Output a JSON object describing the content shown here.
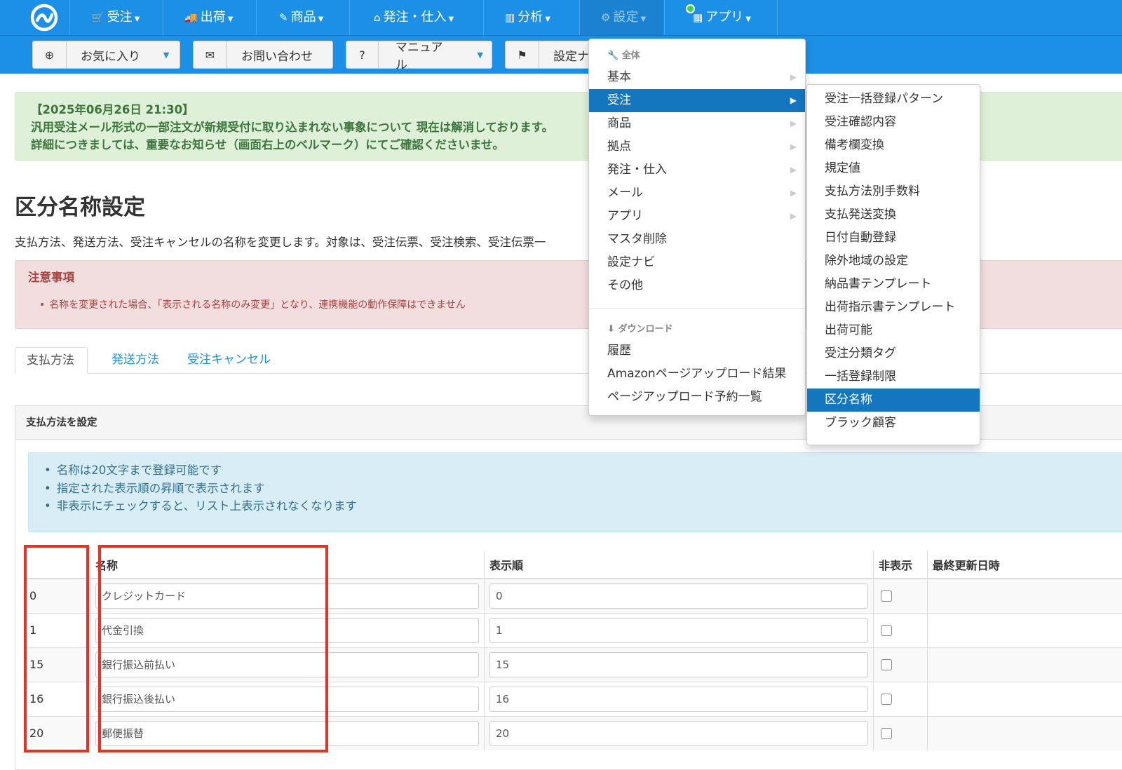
{
  "nav": {
    "items": [
      "受注",
      "出荷",
      "商品",
      "発注・仕入",
      "分析",
      "設定",
      "アプリ"
    ]
  },
  "toolbar": {
    "favorites": "お気に入り",
    "contact": "お問い合わせ",
    "manual": "マニュアル",
    "settings_navi": "設定ナ"
  },
  "notice": {
    "line1": "【2025年06月26日 21:30】",
    "line2": "汎用受注メール形式の一部注文が新規受付に取り込まれない事象について 現在は解消しております。",
    "line3": "詳細につきましては、重要なお知らせ（画面右上のベルマーク）にてご確認くださいませ。"
  },
  "page": {
    "title": "区分名称設定",
    "description": "支払方法、発送方法、受注キャンセルの名称を変更します。対象は、受注伝票、受注検索、受注伝票一"
  },
  "caution": {
    "heading": "注意事項",
    "item": "名称を変更された場合、「表示される名称のみ変更」となり、連携機能の動作保障はできません"
  },
  "tabs": [
    "支払方法",
    "発送方法",
    "受注キャンセル"
  ],
  "panel": {
    "heading": "支払方法を設定",
    "info": [
      "名称は20文字まで登録可能です",
      "指定された表示順の昇順で表示されます",
      "非表示にチェックすると、リスト上表示されなくなります"
    ]
  },
  "table": {
    "headers": [
      "",
      "名称",
      "表示順",
      "非表示",
      "最終更新日時"
    ],
    "rows": [
      {
        "id": "0",
        "name": "クレジットカード",
        "order": "0"
      },
      {
        "id": "1",
        "name": "代金引換",
        "order": "1"
      },
      {
        "id": "15",
        "name": "銀行振込前払い",
        "order": "15"
      },
      {
        "id": "16",
        "name": "銀行振込後払い",
        "order": "16"
      },
      {
        "id": "20",
        "name": "郵便振替",
        "order": "20"
      }
    ]
  },
  "menu": {
    "section_all": "全体",
    "items": [
      "基本",
      "受注",
      "商品",
      "拠点",
      "発注・仕入",
      "メール",
      "アプリ",
      "マスタ削除",
      "設定ナビ",
      "その他"
    ],
    "section_download": "ダウンロード",
    "download_items": [
      "履歴",
      "Amazonページアップロード結果",
      "ページアップロード予約一覧"
    ]
  },
  "submenu": {
    "items": [
      "受注一括登録パターン",
      "受注確認内容",
      "備考欄変換",
      "規定値",
      "支払方法別手数料",
      "支払発送変換",
      "日付自動登録",
      "除外地域の設定",
      "納品書テンプレート",
      "出荷指示書テンプレート",
      "出荷可能",
      "受注分類タグ",
      "一括登録制限",
      "区分名称",
      "ブラック顧客"
    ]
  }
}
